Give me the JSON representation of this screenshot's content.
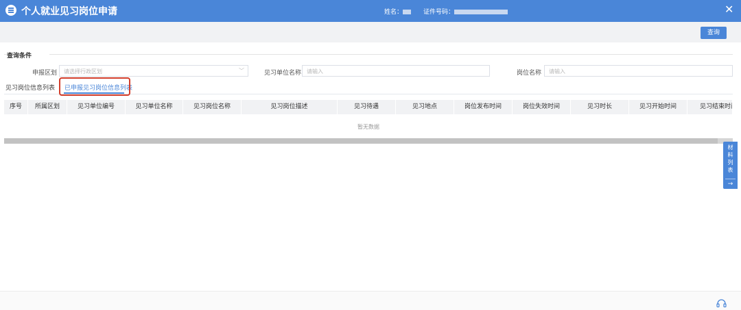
{
  "window": {
    "title": "个人就业见习岗位申请",
    "name_label": "姓名：",
    "id_label": "证件号码：",
    "close_glyph": "✕"
  },
  "toolbar": {
    "query_label": "查询"
  },
  "filter": {
    "section_title": "查询条件",
    "district_label": "申报区划",
    "district_placeholder": "请选择行政区划",
    "unit_label": "见习单位名称",
    "unit_placeholder": "请输入",
    "post_label": "岗位名称",
    "post_placeholder": "请输入"
  },
  "tabs": [
    {
      "label": "见习岗位信息列表",
      "active": false
    },
    {
      "label": "已申报见习岗位信息列表",
      "active": true
    }
  ],
  "table": {
    "columns": [
      "序号",
      "所属区划",
      "见习单位编号",
      "见习单位名称",
      "见习岗位名称",
      "见习岗位描述",
      "见习待遇",
      "见习地点",
      "岗位发布时间",
      "岗位失效时间",
      "见习时长",
      "见习开始时间",
      "见习结束时间"
    ],
    "empty_text": "暂无数据"
  },
  "side_panel": {
    "label": "材料列表",
    "arrow": "→"
  },
  "colors": {
    "primary": "#4a86d8",
    "highlight": "#d23d2a"
  }
}
